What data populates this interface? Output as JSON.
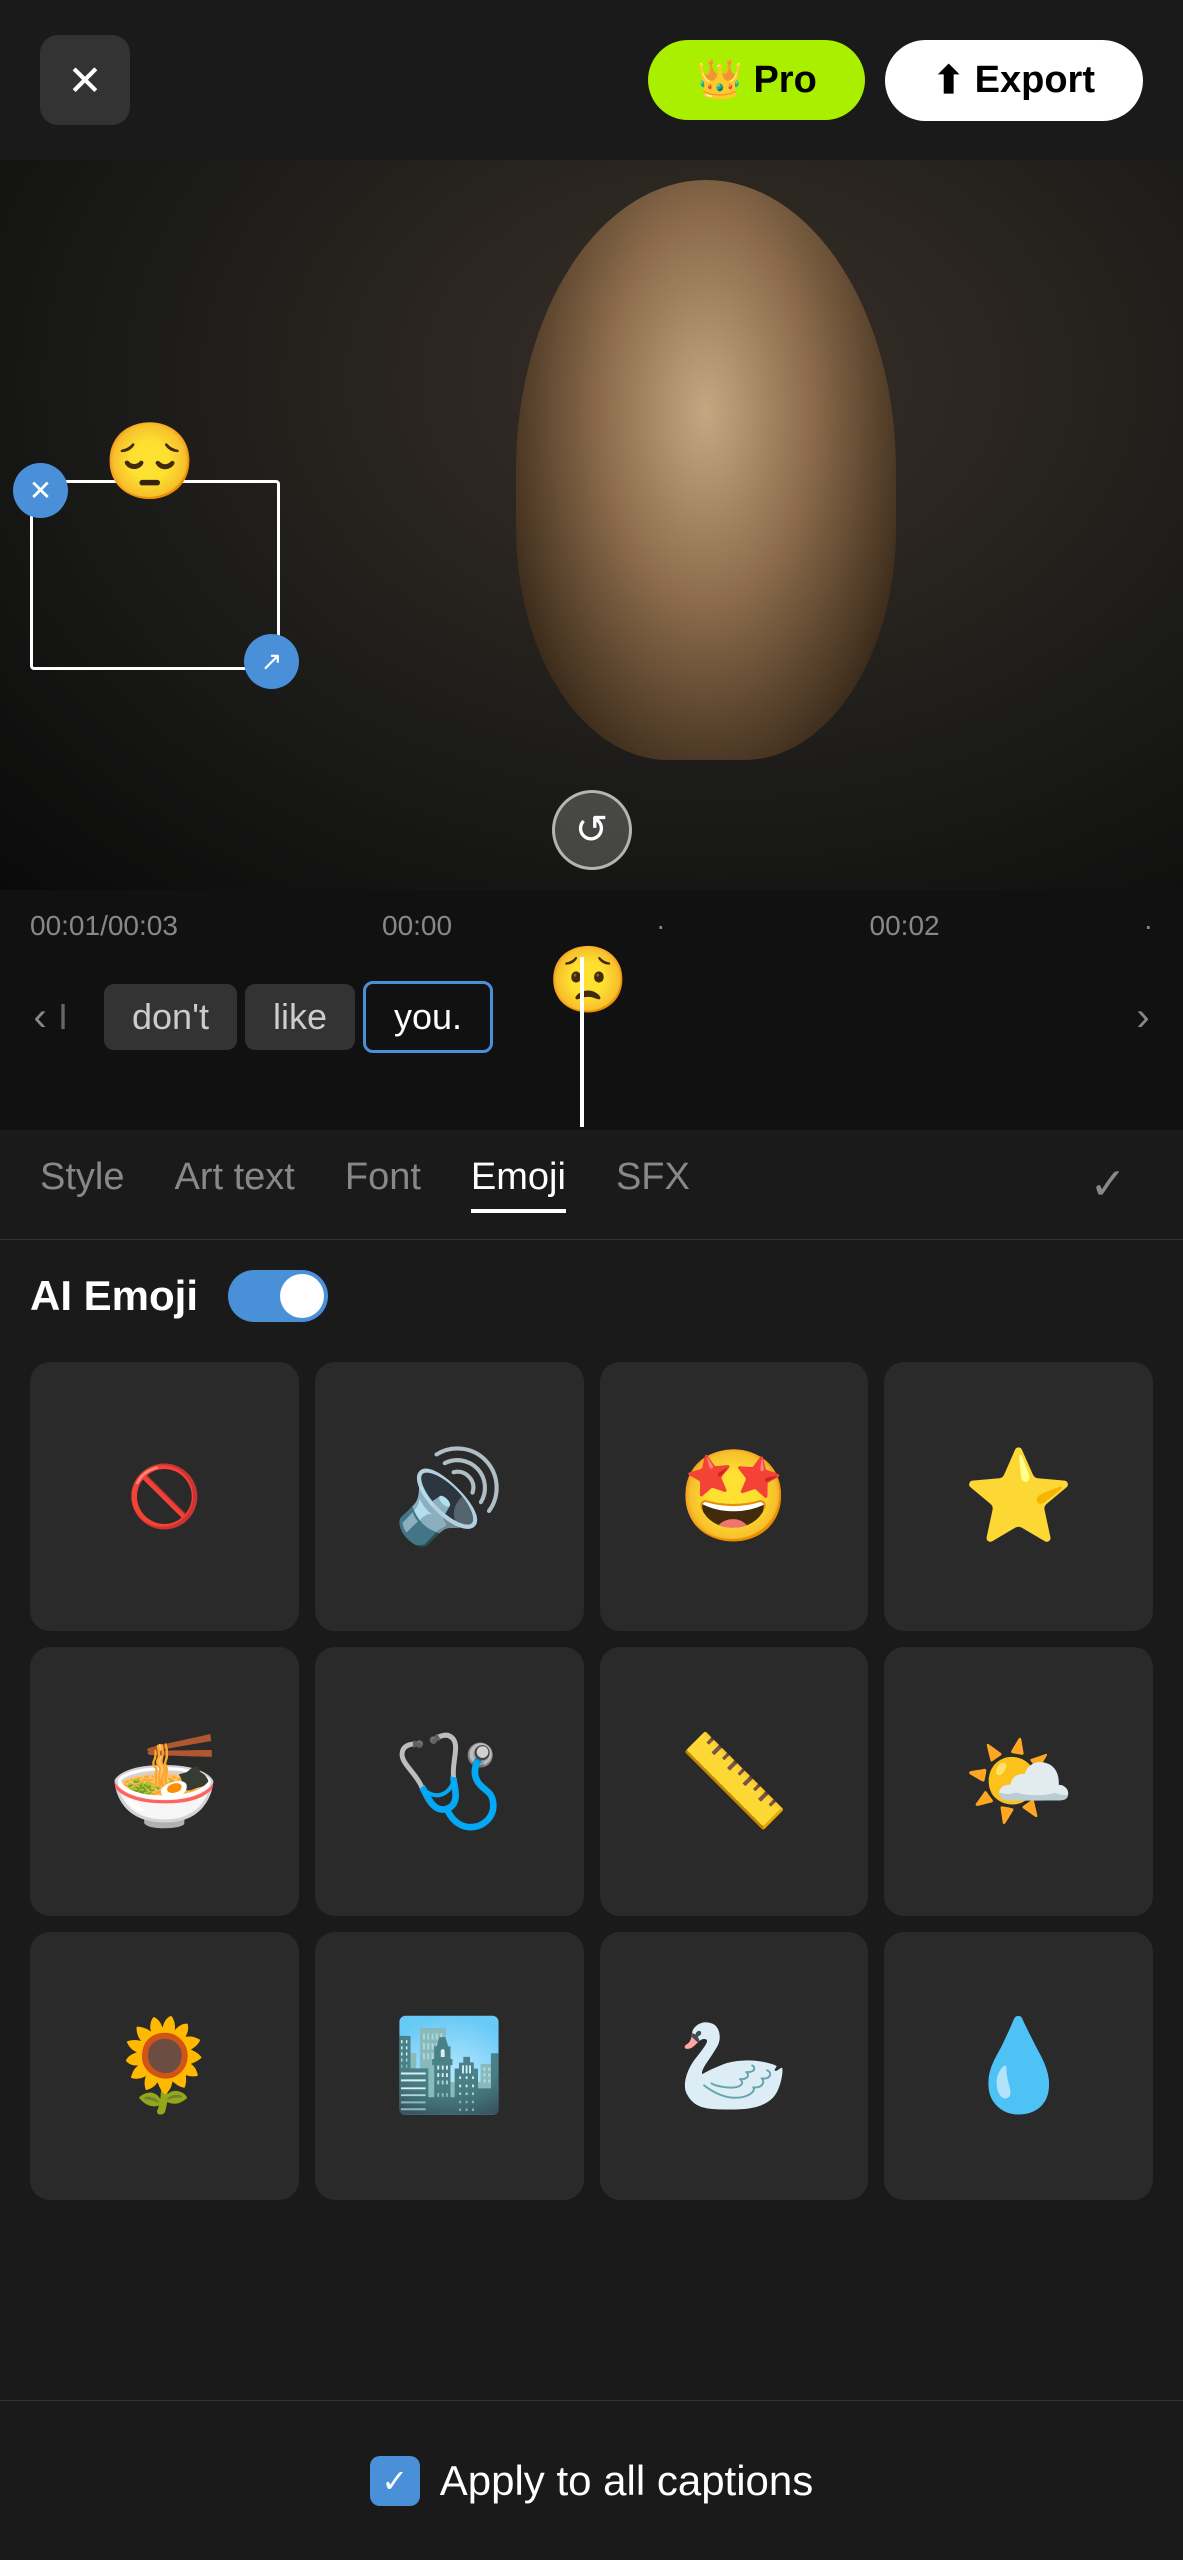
{
  "topBar": {
    "closeIcon": "✕",
    "proLabel": "Pro",
    "proIcon": "👑",
    "exportLabel": "Export",
    "exportIcon": "⬆"
  },
  "timeline": {
    "currentTime": "00:01",
    "totalTime": "00:03",
    "mark1": "00:00",
    "mark2": "00:02",
    "words": [
      {
        "text": "I",
        "state": "faint"
      },
      {
        "text": "don't",
        "state": "normal"
      },
      {
        "text": "like",
        "state": "normal"
      },
      {
        "text": "you.",
        "state": "active"
      }
    ]
  },
  "tabs": [
    {
      "label": "Style",
      "active": false
    },
    {
      "label": "Art text",
      "active": false
    },
    {
      "label": "Font",
      "active": false
    },
    {
      "label": "Emoji",
      "active": true
    },
    {
      "label": "SFX",
      "active": false
    }
  ],
  "checkIcon": "✓",
  "emojiPanel": {
    "aiEmojiLabel": "AI Emoji",
    "toggleOn": true
  },
  "emojis": [
    {
      "symbol": "🚫",
      "type": "disabled"
    },
    {
      "symbol": "🔊",
      "type": "emoji"
    },
    {
      "symbol": "🤩",
      "type": "emoji"
    },
    {
      "symbol": "⭐",
      "type": "emoji"
    },
    {
      "symbol": "🍜",
      "type": "emoji"
    },
    {
      "symbol": "🩺",
      "type": "emoji"
    },
    {
      "symbol": "📏",
      "type": "emoji"
    },
    {
      "symbol": "🌤",
      "type": "emoji"
    },
    {
      "symbol": "🌻",
      "type": "emoji"
    },
    {
      "symbol": "🏙",
      "type": "emoji"
    },
    {
      "symbol": "🦢",
      "type": "emoji"
    },
    {
      "symbol": "💧",
      "type": "emoji"
    }
  ],
  "applyBar": {
    "checkIcon": "✓",
    "label": "Apply to all captions"
  },
  "captionEmoji": "😔",
  "timelineEmoji": "😟"
}
